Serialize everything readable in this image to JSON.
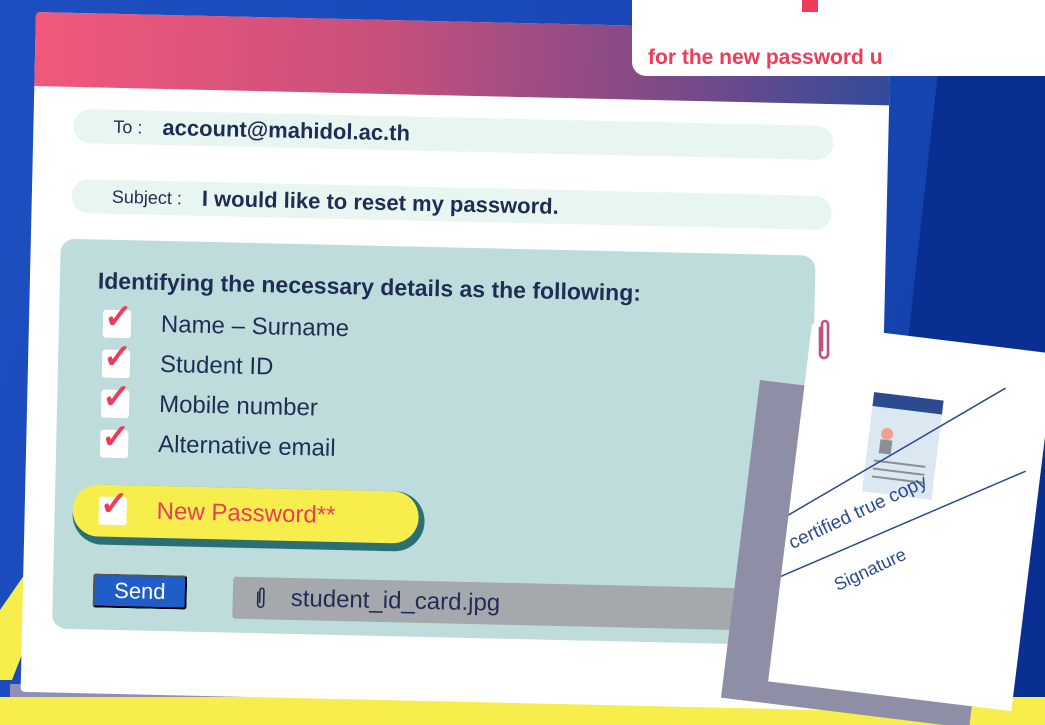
{
  "email": {
    "to_label": "To :",
    "to_value": "account@mahidol.ac.th",
    "subject_label": "Subject :",
    "subject_value": "I would like to reset my password.",
    "body_heading": "Identifying the necessary details as the following:",
    "checklist": [
      {
        "label": "Name – Surname",
        "checked": true
      },
      {
        "label": "Student ID",
        "checked": true
      },
      {
        "label": "Mobile number",
        "checked": true
      },
      {
        "label": "Alternative email",
        "checked": true
      },
      {
        "label": "New Password**",
        "checked": true,
        "highlighted": true
      }
    ],
    "send_label": "Send",
    "attachment_name": "student_id_card.jpg"
  },
  "top_banner": {
    "text": "for the new password u"
  },
  "document": {
    "stamp_text": "certified true copy",
    "signature_text": "Signature"
  },
  "colors": {
    "background": "#1c4fc0",
    "accent_red": "#ee3b5a",
    "highlight_yellow": "#f7ee4e",
    "body_box": "#bfdcdc",
    "send_button": "#1f5ec8"
  },
  "icons": {
    "check": "check-mark-icon",
    "attachment": "paperclip-icon",
    "id_card": "id-card-icon"
  }
}
